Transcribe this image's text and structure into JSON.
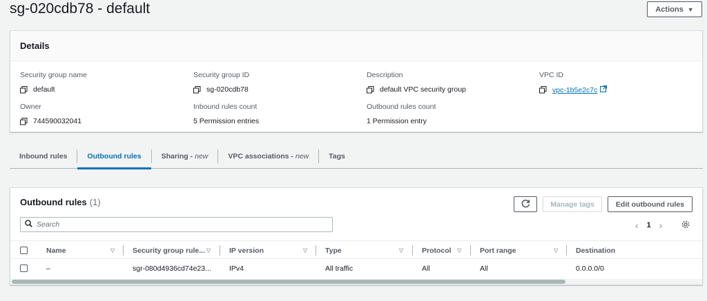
{
  "page": {
    "title": "sg-020cdb78 - default",
    "actions_label": "Actions"
  },
  "details": {
    "title": "Details",
    "items": [
      {
        "label": "Security group name",
        "value": "default",
        "copy": true
      },
      {
        "label": "Security group ID",
        "value": "sg-020cdb78",
        "copy": true
      },
      {
        "label": "Description",
        "value": "default VPC security group",
        "copy": true
      },
      {
        "label": "VPC ID",
        "value": "vpc-1b5e2c7c",
        "copy": true,
        "link": true
      },
      {
        "label": "Owner",
        "value": "744590032041",
        "copy": true
      },
      {
        "label": "Inbound rules count",
        "value": "5 Permission entries",
        "copy": false
      },
      {
        "label": "Outbound rules count",
        "value": "1 Permission entry",
        "copy": false
      }
    ]
  },
  "tabs": [
    {
      "label": "Inbound rules",
      "suffix": ""
    },
    {
      "label": "Outbound rules",
      "suffix": "",
      "active": true
    },
    {
      "label": "Sharing - ",
      "suffix": "new"
    },
    {
      "label": "VPC associations - ",
      "suffix": "new"
    },
    {
      "label": "Tags",
      "suffix": ""
    }
  ],
  "outbound": {
    "title": "Outbound rules",
    "count": "(1)",
    "refresh_icon": "refresh-icon",
    "manage_tags_label": "Manage tags",
    "edit_label": "Edit outbound rules",
    "search_placeholder": "Search",
    "page_number": "1",
    "columns": [
      "Name",
      "Security group rule...",
      "IP version",
      "Type",
      "Protocol",
      "Port range",
      "Destination"
    ],
    "rows": [
      [
        "–",
        "sgr-080d4936cd74e23...",
        "IPv4",
        "All traffic",
        "All",
        "All",
        "0.0.0.0/0"
      ]
    ]
  },
  "colors": {
    "accent": "#0073bb",
    "text": "#16191f",
    "muted": "#545b64"
  }
}
